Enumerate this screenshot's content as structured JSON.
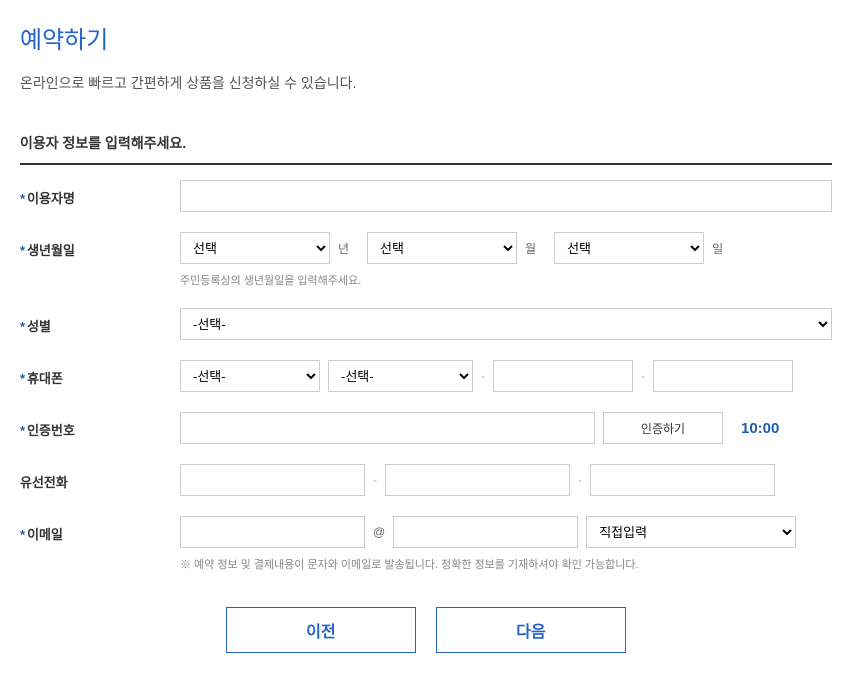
{
  "page": {
    "title": "예약하기",
    "subtitle": "온라인으로 빠르고 간편하게 상품을 신청하실 수 있습니다."
  },
  "section": {
    "title": "이용자 정보를 입력해주세요."
  },
  "labels": {
    "username": "이용자명",
    "birthdate": "생년월일",
    "gender": "성별",
    "mobile": "휴대폰",
    "auth_code": "인증번호",
    "landline": "유선전화",
    "email": "이메일",
    "year": "년",
    "month": "월",
    "day": "일",
    "at": "@",
    "dash": "-"
  },
  "options": {
    "select_default": "선택",
    "select_dashed": "-선택-",
    "email_direct": "직접입력"
  },
  "hints": {
    "birthdate": "주민등록상의 생년월일을 입력해주세요.",
    "email_note": "※ 예약 정보 및 결제내용이 문자와 이메일로 발송됩니다. 정확한 정보를 기재하셔야 확인 가능합니다."
  },
  "buttons": {
    "verify": "인증하기",
    "prev": "이전",
    "next": "다음"
  },
  "timer": "10:00"
}
